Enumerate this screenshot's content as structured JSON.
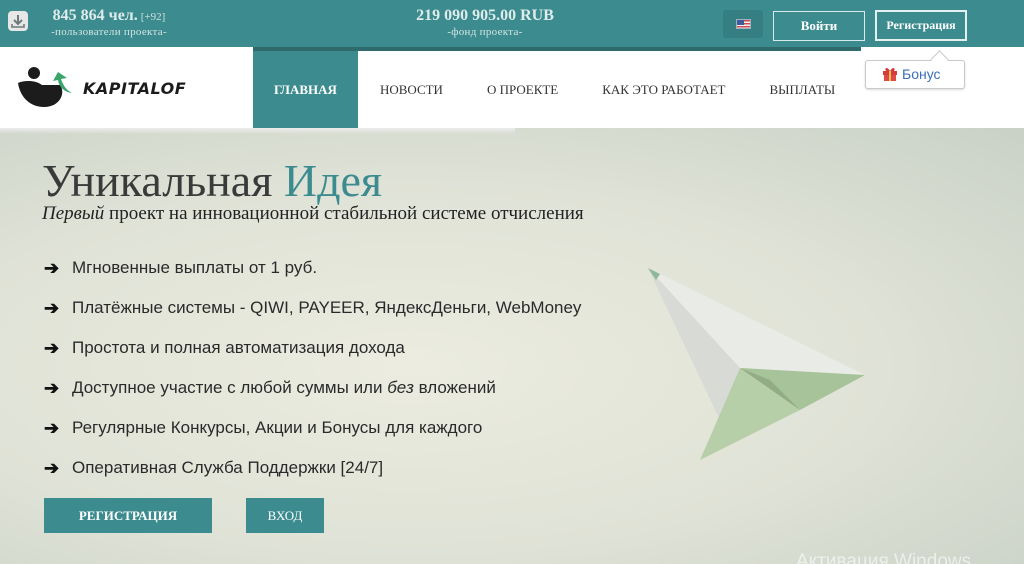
{
  "topbar": {
    "users_count": "845 864 чел.",
    "users_delta": "[+92]",
    "users_caption": "-пользователи проекта-",
    "fund_amount": "219 090 905.00 RUB",
    "fund_caption": "-фонд проекта-",
    "login_label": "Войти",
    "register_label": "Регистрация",
    "language_flag": "us-flag-icon"
  },
  "header": {
    "logo_text": "KAPITALOF",
    "bonus_label": "Бонус",
    "nav": [
      {
        "label": "ГЛАВНАЯ",
        "active": true
      },
      {
        "label": "НОВОСТИ",
        "active": false
      },
      {
        "label": "О ПРОЕКТЕ",
        "active": false
      },
      {
        "label": "КАК ЭТО РАБОТАЕТ",
        "active": false
      },
      {
        "label": "ВЫПЛАТЫ",
        "active": false
      }
    ]
  },
  "hero": {
    "title_main": "Уникальная",
    "title_accent": "Идея",
    "subtitle_em": "Первый",
    "subtitle_rest": " проект на инновационной стабильной системе отчисления",
    "features": [
      {
        "text": "Мгновенные выплаты от 1 руб."
      },
      {
        "text": "Платёжные системы - QIWI, PAYEER, ЯндексДеньги, WebMoney"
      },
      {
        "text": "Простота и полная автоматизация дохода"
      },
      {
        "before": "Доступное участие с любой суммы или ",
        "em": "без",
        "after": " вложений"
      },
      {
        "text": "Регулярные Конкурсы, Акции и Бонусы для каждого"
      },
      {
        "text": "Оперативная Служба Поддержки [24/7]"
      }
    ],
    "register_button": "РЕГИСТРАЦИЯ",
    "enter_button": "ВХОД"
  },
  "watermark": "Активация Windows",
  "colors": {
    "accent": "#3b8b8f",
    "accent_dark": "#2f6a6d",
    "text_dark": "#2a2a2a",
    "link_blue": "#3b6fb6"
  }
}
